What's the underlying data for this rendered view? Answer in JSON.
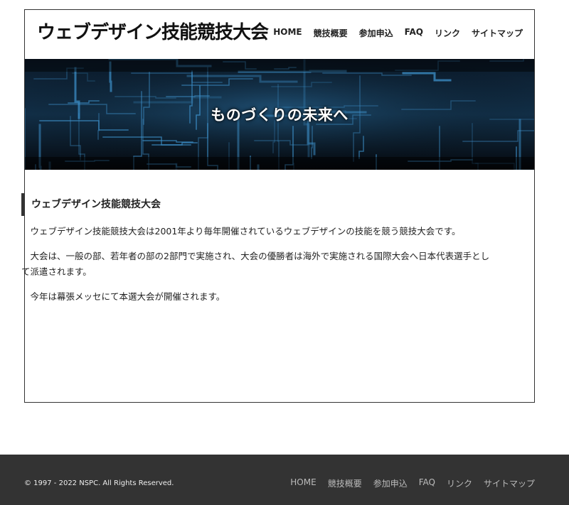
{
  "header": {
    "site_title": "ウェブデザイン技能競技大会",
    "nav": [
      {
        "label": "HOME"
      },
      {
        "label": "競技概要"
      },
      {
        "label": "参加申込"
      },
      {
        "label": "FAQ"
      },
      {
        "label": "リンク"
      },
      {
        "label": "サイトマップ"
      }
    ]
  },
  "hero": {
    "tagline": "ものづくりの未来へ"
  },
  "main": {
    "heading": "ウェブデザイン技能競技大会",
    "paragraphs": [
      "ウェブデザイン技能競技大会は2001年より毎年開催されているウェブデザインの技能を競う競技大会です。",
      "大会は、一般の部、若年者の部の2部門で実施され、大会の優勝者は海外で実施される国際大会へ日本代表選手として派遣されます。",
      "今年は幕張メッセにて本選大会が開催されます。"
    ]
  },
  "footer": {
    "copyright": "© 1997 - 2022 NSPC. All Rights Reserved.",
    "nav": [
      {
        "label": "HOME"
      },
      {
        "label": "競技概要"
      },
      {
        "label": "参加申込"
      },
      {
        "label": "FAQ"
      },
      {
        "label": "リンク"
      },
      {
        "label": "サイトマップ"
      }
    ]
  },
  "colors": {
    "footer_bg": "#333333",
    "hero_bg": "#050a12",
    "hero_lines": "#3d8fc8"
  }
}
